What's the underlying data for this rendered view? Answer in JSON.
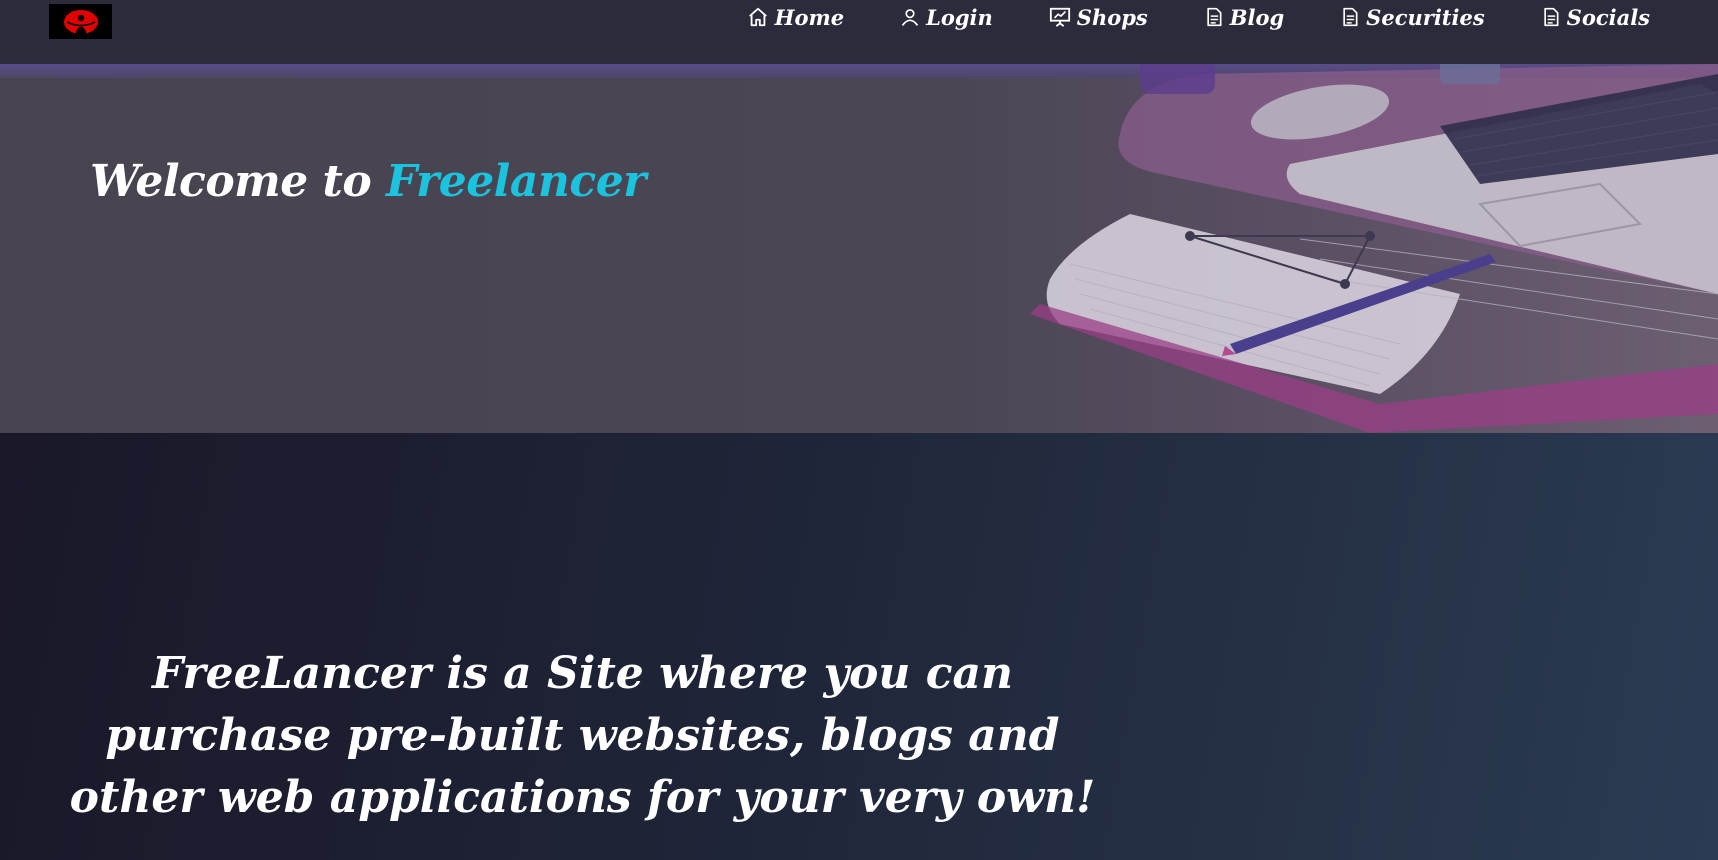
{
  "nav": {
    "items": [
      {
        "label": "Home",
        "icon": "home-icon"
      },
      {
        "label": "Login",
        "icon": "user-icon"
      },
      {
        "label": "Shops",
        "icon": "presentation-icon"
      },
      {
        "label": "Blog",
        "icon": "document-icon"
      },
      {
        "label": "Securities",
        "icon": "document-icon"
      },
      {
        "label": "Socials",
        "icon": "document-icon"
      }
    ]
  },
  "hero": {
    "title_prefix": "Welcome to ",
    "title_accent": "Freelancer"
  },
  "main": {
    "tagline": "FreeLancer is a Site where you can purchase pre-built websites, blogs and other web applications for your very own!"
  },
  "colors": {
    "accent": "#1cc3df",
    "navbar_bg": "#2c2b3c",
    "logo_red": "#e00000"
  }
}
